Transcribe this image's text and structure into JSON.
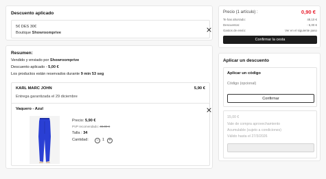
{
  "applied_discount": {
    "title": "Descuento aplicado",
    "code": "5€ DES 30€",
    "boutique_prefix": "Boutique",
    "boutique_name": "Showroomprive"
  },
  "summary": {
    "title": "Resumen:",
    "sold_prefix": "Vendido y enviado por",
    "sold_by": "Showroomprive",
    "discount_prefix": "Descuento aplicado -",
    "discount_value": "5,00 €",
    "reserved_prefix": "Los productos están reservados durante",
    "reserved_time": "9 min 53 seg",
    "vendor": "KARL MARC JOHN",
    "vendor_price": "5,90 €",
    "delivery": "Entrega garantizada el 29 diciembre"
  },
  "product": {
    "name": "Vaquero - Azul",
    "price_label": "Precio:",
    "price": "5,90 €",
    "pvp_label": "PVP recomendado:",
    "pvp_price": "49,00 €",
    "size_label": "Talla :",
    "size": "34",
    "qty_label": "Cantidad:",
    "qty": "1",
    "minus": "−",
    "plus": "+",
    "jeans_color": "#2a3fd4"
  },
  "price_panel": {
    "header": "Precio (1 artículo) :",
    "total": "0,90 €",
    "rows": [
      {
        "label": "Te has ahorrado:",
        "value": "48,10 €"
      },
      {
        "label": "Descuentos:",
        "value": "- 5,00 €"
      },
      {
        "label": "Gastos de envío:",
        "value": "Ver en el siguiente paso"
      }
    ],
    "confirm_label": "Confirmar la cesta",
    "total_color": "#e8202f"
  },
  "apply_discount": {
    "title": "Aplicar un descuento",
    "code_title": "Aplicar un código",
    "code_placeholder": "Código (opcional)",
    "confirm_label": "Confirmar",
    "voucher_amount": "15,00 €",
    "voucher_desc": "Vale de compra aprovechamiento",
    "voucher_note": "Acumulable (sujeto a condiciones)",
    "voucher_valid": "Válido hasta el 27/3/2026"
  }
}
